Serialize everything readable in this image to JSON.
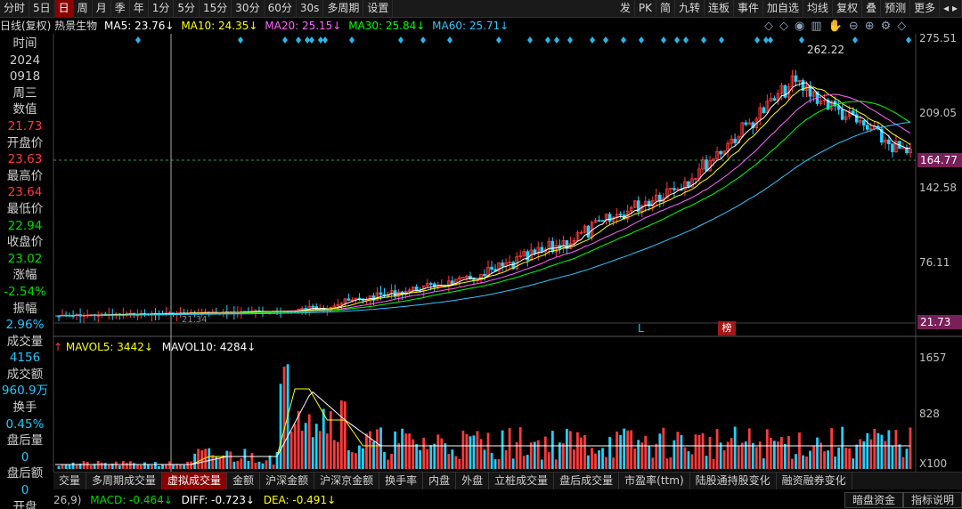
{
  "toolbar": {
    "items": [
      "分时",
      "5日",
      "日",
      "周",
      "月",
      "季",
      "年",
      "1分",
      "5分",
      "15分",
      "30分",
      "60分",
      "30s",
      "多周期",
      "设置"
    ],
    "right_items": [
      "发",
      "PK",
      "简",
      "九转",
      "连板",
      "事件",
      "加自选",
      "均线",
      "复权",
      "叠",
      "预测",
      "更多"
    ],
    "active": "日"
  },
  "ma_header": {
    "title": "日线(复权) 热景生物",
    "ma5": "MA5: 23.76↓",
    "ma10": "MA10: 24.35↓",
    "ma20": "MA20: 25.15↓",
    "ma30": "MA30: 25.84↓",
    "ma60": "MA60: 25.71↓"
  },
  "info_panel": [
    {
      "text": "时间",
      "cls": "lbl"
    },
    {
      "text": "2024",
      "cls": "lbl"
    },
    {
      "text": "0918",
      "cls": "lbl"
    },
    {
      "text": "周三",
      "cls": "lbl"
    },
    {
      "text": "数值",
      "cls": "lbl"
    },
    {
      "text": "21.73",
      "cls": "red"
    },
    {
      "text": "开盘价",
      "cls": "lbl"
    },
    {
      "text": "23.63",
      "cls": "red"
    },
    {
      "text": "最高价",
      "cls": "lbl"
    },
    {
      "text": "23.64",
      "cls": "red"
    },
    {
      "text": "最低价",
      "cls": "lbl"
    },
    {
      "text": "22.94",
      "cls": "green"
    },
    {
      "text": "收盘价",
      "cls": "lbl"
    },
    {
      "text": "23.02",
      "cls": "green"
    },
    {
      "text": "涨幅",
      "cls": "lbl"
    },
    {
      "text": "-2.54%",
      "cls": "green"
    },
    {
      "text": "振幅",
      "cls": "lbl"
    },
    {
      "text": "2.96%",
      "cls": "cyan"
    },
    {
      "text": "成交量",
      "cls": "lbl"
    },
    {
      "text": "4156",
      "cls": "cyan"
    },
    {
      "text": "成交额",
      "cls": "lbl"
    },
    {
      "text": "960.9万",
      "cls": "cyan"
    },
    {
      "text": "换手",
      "cls": "lbl"
    },
    {
      "text": "0.45%",
      "cls": "cyan"
    },
    {
      "text": "盘后量",
      "cls": "lbl"
    },
    {
      "text": "0",
      "cls": "cyan"
    },
    {
      "text": "盘后额",
      "cls": "lbl"
    },
    {
      "text": "0",
      "cls": "cyan"
    },
    {
      "text": "开盘",
      "cls": "lbl"
    }
  ],
  "price_axis": {
    "labels": [
      "275.51",
      "209.05",
      "142.58",
      "76.11"
    ],
    "current_price": "164.77",
    "bottom_price": "21.73",
    "peak_label": "262.22",
    "low_label": "21.34"
  },
  "volume_axis": {
    "labels": [
      "1657",
      "828"
    ],
    "unit": "X100"
  },
  "volume_header": {
    "mavol5": "MAVOL5: 3442↓",
    "mavol10": "MAVOL10: 4284↓"
  },
  "markers": {
    "l_marker": "L",
    "bang_marker": "榜"
  },
  "tabs": [
    "交量",
    "多周期成交量",
    "虚拟成交量",
    "金额",
    "沪深金额",
    "沪深京金额",
    "换手率",
    "内盘",
    "外盘",
    "立桩成交量",
    "盘后成交量",
    "市盈率(ttm)",
    "陆股通持股变化",
    "融资融券变化"
  ],
  "active_tab": "虚拟成交量",
  "macd_line": {
    "params": "26,9)",
    "macd": "MACD: -0.464↓",
    "diff": "DIFF: -0.723↓",
    "dea": "DEA: -0.491↓"
  },
  "bottom_buttons": [
    "暗盘资金",
    "指标说明"
  ],
  "colors": {
    "up": "#ff3b3b",
    "down": "#22d0ff",
    "ma5": "#ffffff",
    "ma10": "#ffff00",
    "ma20": "#ff66ff",
    "ma30": "#00ff00",
    "ma60": "#33c8ff"
  }
}
